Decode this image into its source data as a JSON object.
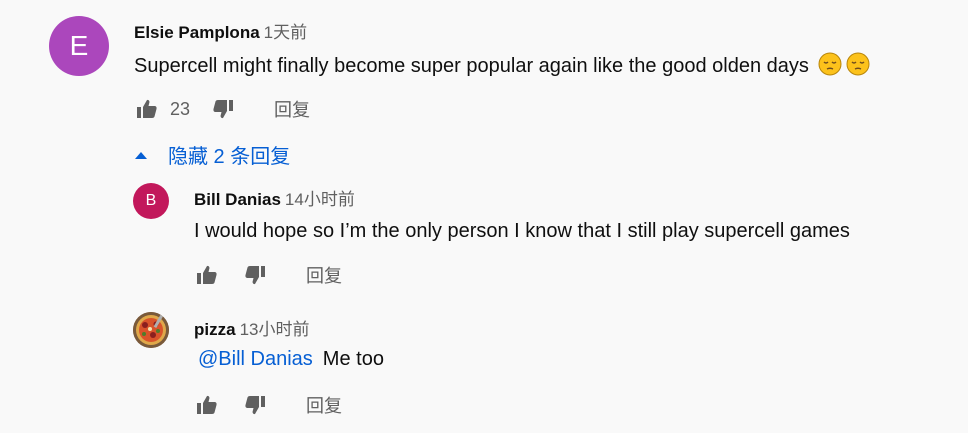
{
  "comments": [
    {
      "avatar_letter": "E",
      "avatar_color": "#ab47bc",
      "author": "Elsie Pamplona",
      "time": "1天前",
      "text": "Supercell might finally become super popular again like the good olden days",
      "emojis": [
        "pensive-face",
        "pensive-face"
      ],
      "likes": "23",
      "reply_label": "回复"
    }
  ],
  "toggle": {
    "label": "隐藏 2 条回复",
    "icon": "triangle-up-icon"
  },
  "replies": [
    {
      "avatar_letter": "B",
      "avatar_color": "#c2185b",
      "author": "Bill Danias",
      "time": "14小时前",
      "text": "I would hope so I’m the only person I know that I still play supercell games",
      "reply_label": "回复"
    },
    {
      "avatar_image": "pizza-photo",
      "author": "pizza",
      "time": "13小时前",
      "mention": "@Bill Danias",
      "text": "Me too",
      "reply_label": "回复"
    }
  ],
  "colors": {
    "link": "#065fd4",
    "meta": "#606060",
    "background": "#f9f9f9"
  }
}
